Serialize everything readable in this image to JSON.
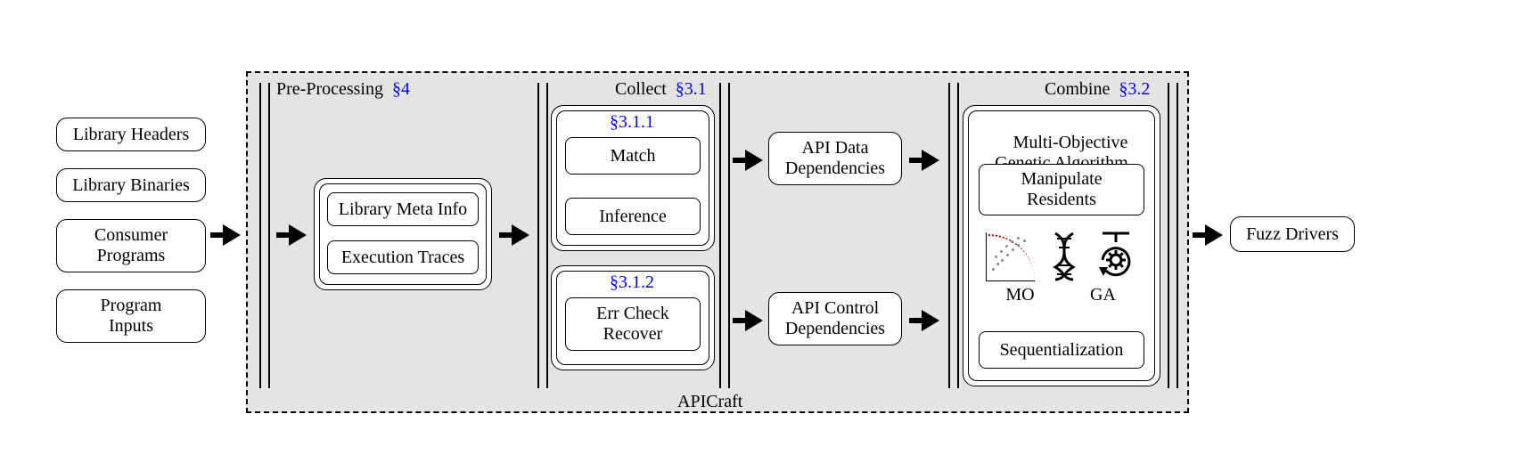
{
  "inputs": {
    "headers": "Library Headers",
    "binaries": "Library Binaries",
    "consumers": "Consumer\nPrograms",
    "program_inputs": "Program\nInputs"
  },
  "frame": {
    "caption": "APICraft"
  },
  "stages": {
    "pre": {
      "label": "Pre-Processing",
      "ref": "§4"
    },
    "collect": {
      "label": "Collect",
      "ref": "§3.1"
    },
    "combine": {
      "label": "Combine",
      "ref": "§3.2"
    }
  },
  "pre": {
    "meta": "Library Meta Info",
    "traces": "Execution Traces"
  },
  "collect": {
    "top_ref": "§3.1.1",
    "match": "Match",
    "inference": "Inference",
    "bot_ref": "§3.1.2",
    "err": "Err Check\nRecover"
  },
  "deps": {
    "data": "API Data\nDependencies",
    "control": "API Control\nDependencies"
  },
  "combine": {
    "title": "Multi-Objective\nGenetic Algorithm",
    "manipulate": "Manipulate\nResidents",
    "mo": "MO",
    "ga": "GA",
    "sequential": "Sequentialization"
  },
  "output": {
    "fuzz": "Fuzz Drivers"
  }
}
